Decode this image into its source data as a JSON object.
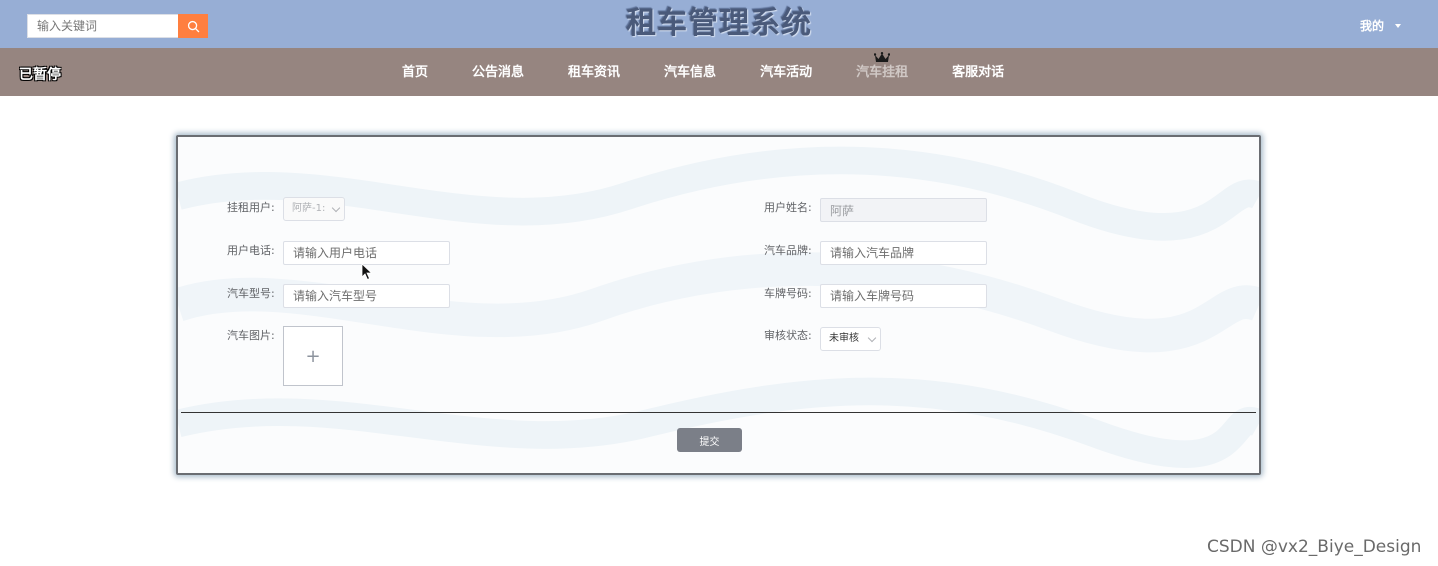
{
  "header": {
    "search_placeholder": "输入关键词",
    "site_title": "租车管理系统",
    "user_menu_label": "我的"
  },
  "nav": {
    "status": "已暂停",
    "items": [
      {
        "label": "首页"
      },
      {
        "label": "公告消息"
      },
      {
        "label": "租车资讯"
      },
      {
        "label": "汽车信息"
      },
      {
        "label": "汽车活动"
      },
      {
        "label": "汽车挂租",
        "active": true
      },
      {
        "label": "客服对话"
      }
    ]
  },
  "form": {
    "rent_user_label": "挂租用户:",
    "rent_user_value": "阿萨-1:",
    "user_name_label": "用户姓名:",
    "user_name_value": "阿萨",
    "user_phone_label": "用户电话:",
    "user_phone_placeholder": "请输入用户电话",
    "car_brand_label": "汽车品牌:",
    "car_brand_placeholder": "请输入汽车品牌",
    "car_model_label": "汽车型号:",
    "car_model_placeholder": "请输入汽车型号",
    "plate_number_label": "车牌号码:",
    "plate_number_placeholder": "请输入车牌号码",
    "car_image_label": "汽车图片:",
    "upload_symbol": "+",
    "review_status_label": "审核状态:",
    "review_status_value": "未审核",
    "submit_label": "提交"
  },
  "watermark": "CSDN @vx2_Biye_Design",
  "colors": {
    "topbar": "#97aed5",
    "navbar": "#968580",
    "search_button": "#ff7f3f",
    "submit_button": "#7b7f88"
  }
}
